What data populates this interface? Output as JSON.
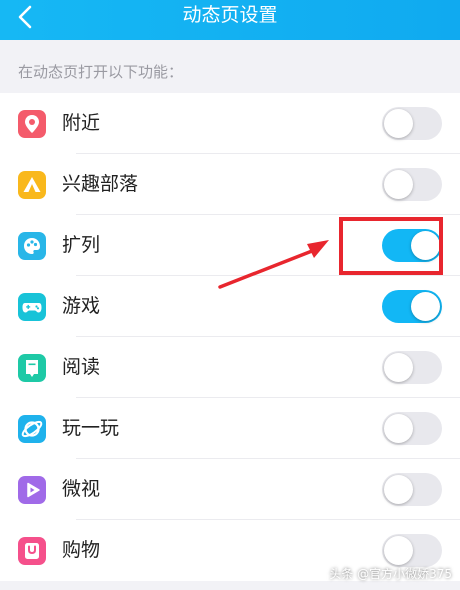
{
  "header": {
    "title": "动态页设置",
    "back_icon": "chevron-left-icon"
  },
  "section_header": "在动态页打开以下功能：",
  "items": [
    {
      "label": "附近",
      "icon": "location-pin-icon",
      "enabled": false
    },
    {
      "label": "兴趣部落",
      "icon": "triangle-tribe-icon",
      "enabled": false
    },
    {
      "label": "扩列",
      "icon": "palette-icon",
      "enabled": true
    },
    {
      "label": "游戏",
      "icon": "gamepad-icon",
      "enabled": true
    },
    {
      "label": "阅读",
      "icon": "book-icon",
      "enabled": false
    },
    {
      "label": "玩一玩",
      "icon": "planet-icon",
      "enabled": false
    },
    {
      "label": "微视",
      "icon": "play-icon",
      "enabled": false
    },
    {
      "label": "购物",
      "icon": "shopping-bag-icon",
      "enabled": false
    }
  ],
  "colors": {
    "accent": "#12b7f5",
    "annotation": "#e8262e"
  },
  "watermark": "头条 @官方小微娇375"
}
